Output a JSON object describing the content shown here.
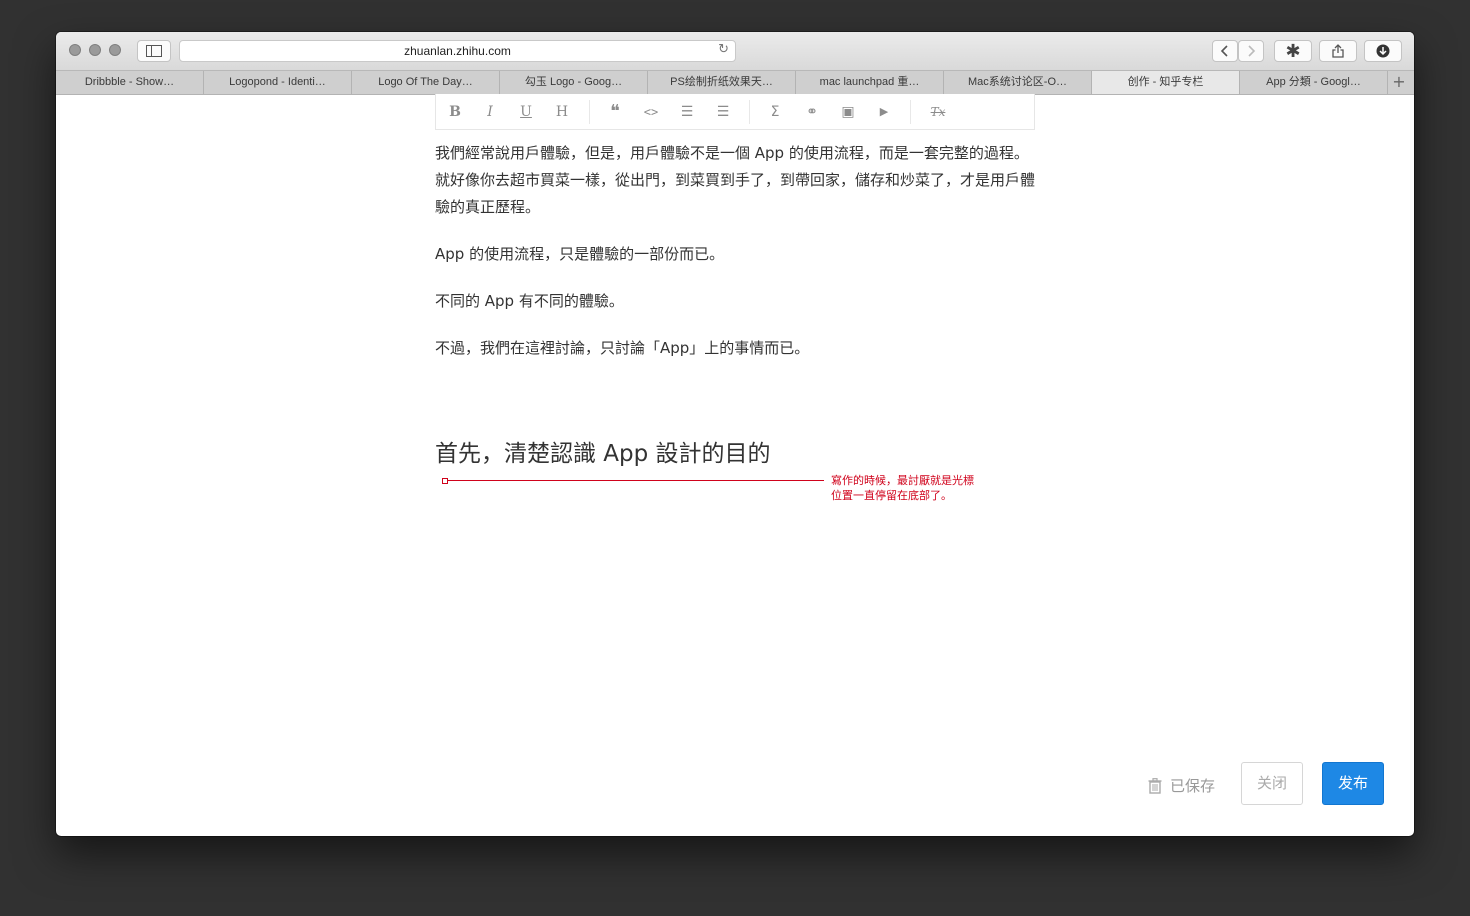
{
  "browser": {
    "url": "zhuanlan.zhihu.com",
    "tabs": [
      {
        "label": "Dribbble - Show…"
      },
      {
        "label": "Logopond - Identi…"
      },
      {
        "label": "Logo Of The Day…"
      },
      {
        "label": "勾玉 Logo - Goog…"
      },
      {
        "label": "PS绘制折纸效果天…"
      },
      {
        "label": "mac launchpad 重…"
      },
      {
        "label": "Mac系统讨论区-O…"
      },
      {
        "label": "创作 - 知乎专栏"
      },
      {
        "label": "App 分類 - Googl…"
      }
    ],
    "active_tab_index": 7,
    "add_tab": "+"
  },
  "toolbar": {
    "bold": "B",
    "italic": "I",
    "underline": "U",
    "heading": "H",
    "quote": "❝",
    "code": "<>",
    "ordered_list": "☰",
    "unordered_list": "☰",
    "formula": "Σ",
    "link": "⚭",
    "image": "▣",
    "video": "▶",
    "clear_format": "Tx"
  },
  "content": {
    "paragraphs": [
      "我們經常說用戶體驗，但是，用戶體驗不是一個 App 的使用流程，而是一套完整的過程。就好像你去超市買菜一樣，從出門，到菜買到手了，到帶回家，儲存和炒菜了，才是用戶體驗的真正歷程。",
      "App 的使用流程，只是體驗的一部份而已。",
      "不同的 App 有不同的體驗。",
      "不過，我們在這裡討論，只討論「App」上的事情而已。"
    ],
    "heading": "首先，清楚認識 App 設計的目的"
  },
  "annotation": {
    "line1": "寫作的時候，最討厭就是光標",
    "line2": "位置一直停留在底部了。"
  },
  "footer": {
    "saved_label": "已保存",
    "close_label": "关闭",
    "publish_label": "发布"
  }
}
